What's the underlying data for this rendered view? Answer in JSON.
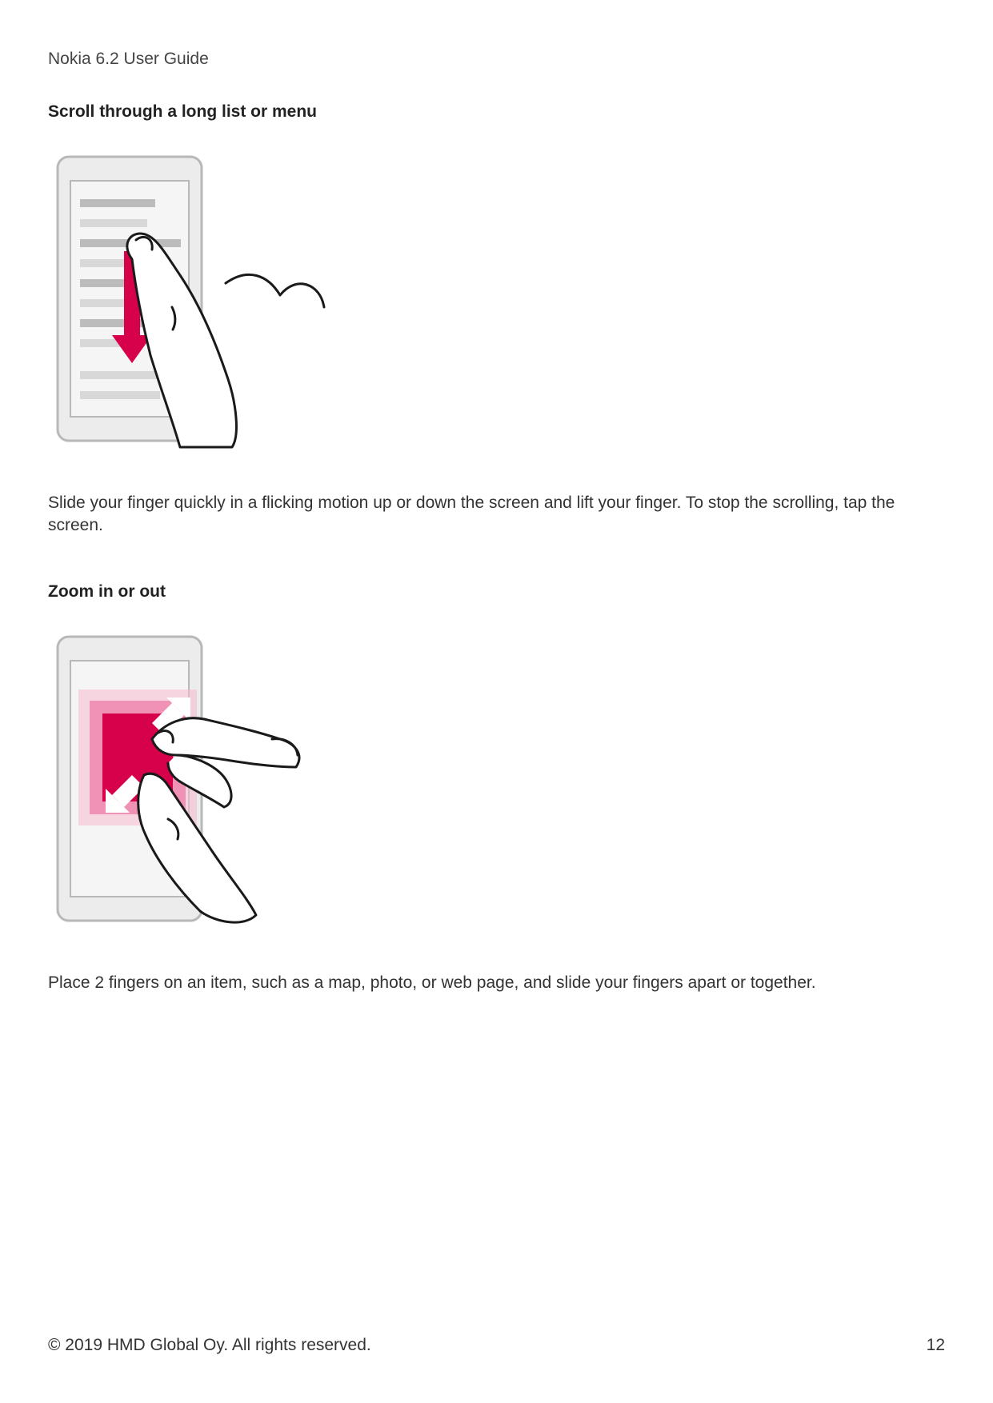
{
  "doc_title": "Nokia 6.2 User Guide",
  "sections": {
    "scroll": {
      "heading": "Scroll through a long list or menu",
      "body": "Slide your finger quickly in a flicking motion up or down the screen and lift your finger. To stop the scrolling, tap the screen."
    },
    "zoom": {
      "heading": "Zoom in or out",
      "body": "Place 2 fingers on an item, such as a map, photo, or web page, and slide your fingers apart or together."
    }
  },
  "footer": {
    "copyright": "© 2019 HMD Global Oy. All rights reserved.",
    "page_number": "12"
  },
  "colors": {
    "accent": "#d6004b",
    "phone_stroke": "#b8b8b8",
    "screen_fill": "#f5f5f5",
    "line_dark": "#bcbcbc",
    "line_light": "#d8d8d8",
    "hand_stroke": "#1a1a1a"
  }
}
